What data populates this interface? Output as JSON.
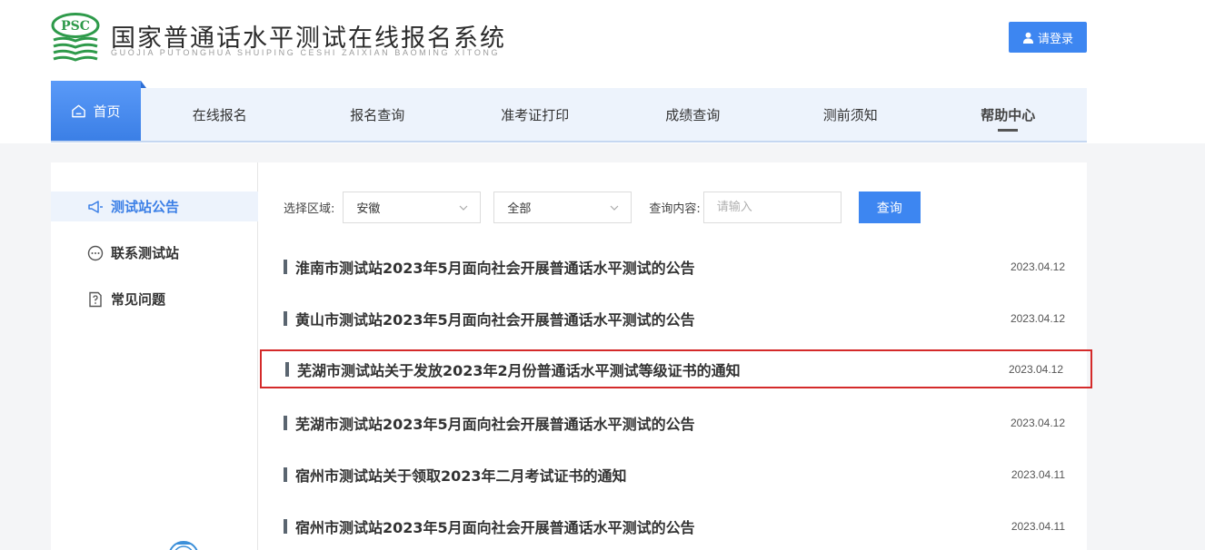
{
  "header": {
    "logo_text": "PSC",
    "title": "国家普通话水平测试在线报名系统",
    "subtitle": "GUOJIA PUTONGHUA SHUIPING CESHI ZAIXIAN BAOMING XITONG",
    "login_label": "请登录"
  },
  "nav": {
    "items": [
      {
        "label": "首页"
      },
      {
        "label": "在线报名"
      },
      {
        "label": "报名查询"
      },
      {
        "label": "准考证打印"
      },
      {
        "label": "成绩查询"
      },
      {
        "label": "测前须知"
      },
      {
        "label": "帮助中心"
      }
    ]
  },
  "sidebar": {
    "items": [
      {
        "label": "测试站公告",
        "icon": "megaphone-icon"
      },
      {
        "label": "联系测试站",
        "icon": "chat-bubble-icon"
      },
      {
        "label": "常见问题",
        "icon": "document-question-icon"
      }
    ]
  },
  "filter": {
    "region_label": "选择区域:",
    "region_value": "安徽",
    "scope_value": "全部",
    "query_label": "查询内容:",
    "query_placeholder": "请输入",
    "query_button": "查询"
  },
  "notices": [
    {
      "title": "淮南市测试站2023年5月面向社会开展普通话水平测试的公告",
      "date": "2023.04.12"
    },
    {
      "title": "黄山市测试站2023年5月面向社会开展普通话水平测试的公告",
      "date": "2023.04.12"
    },
    {
      "title": "芜湖市测试站关于发放2023年2月份普通话水平测试等级证书的通知",
      "date": "2023.04.12"
    },
    {
      "title": "芜湖市测试站2023年5月面向社会开展普通话水平测试的公告",
      "date": "2023.04.12"
    },
    {
      "title": "宿州市测试站关于领取2023年二月考试证书的通知",
      "date": "2023.04.11"
    },
    {
      "title": "宿州市测试站2023年5月面向社会开展普通话水平测试的公告",
      "date": "2023.04.11"
    }
  ],
  "colors": {
    "accent": "#3d86f1",
    "highlight_border": "#d42a2a",
    "logo_green": "#2e9a4a"
  }
}
